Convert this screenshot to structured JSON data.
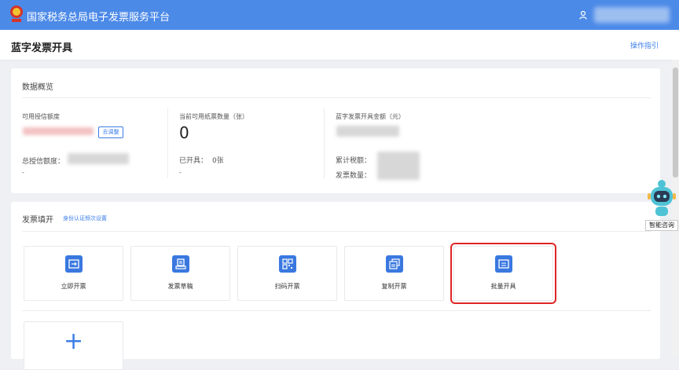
{
  "header": {
    "app_title": "国家税务总局电子发票服务平台"
  },
  "subheader": {
    "page_title": "蓝字发票开具",
    "guide_link": "操作指引"
  },
  "overview": {
    "section_title": "数据概览",
    "available_credit_label": "可用授信额度",
    "adjust_button": "去调整",
    "total_credit_label": "总授信额度：",
    "total_credit_value": "-",
    "paper_count_label": "当前可用纸票数量（张）",
    "paper_count_value": "0",
    "issued_label": "已开具：",
    "issued_value": "0张",
    "paper_dash": "-",
    "blue_amount_label": "蓝字发票开具金额（元）",
    "tax_total_label": "累计税额：",
    "invoice_count_label": "发票数量："
  },
  "issue": {
    "section_title": "发票填开",
    "auth_link": "身份认证频次设置",
    "tiles": [
      {
        "label": "立即开票",
        "icon": "instant-invoice-icon"
      },
      {
        "label": "发票草稿",
        "icon": "draft-icon"
      },
      {
        "label": "扫码开票",
        "icon": "qrcode-icon"
      },
      {
        "label": "复制开票",
        "icon": "copy-invoice-icon"
      },
      {
        "label": "批量开具",
        "icon": "batch-issue-icon"
      }
    ],
    "add_tile_icon": "plus-icon"
  },
  "assistant": {
    "label": "智能咨询"
  },
  "colors": {
    "primary": "#4c8ae8",
    "link": "#3b7de9",
    "highlight": "#e02525"
  }
}
